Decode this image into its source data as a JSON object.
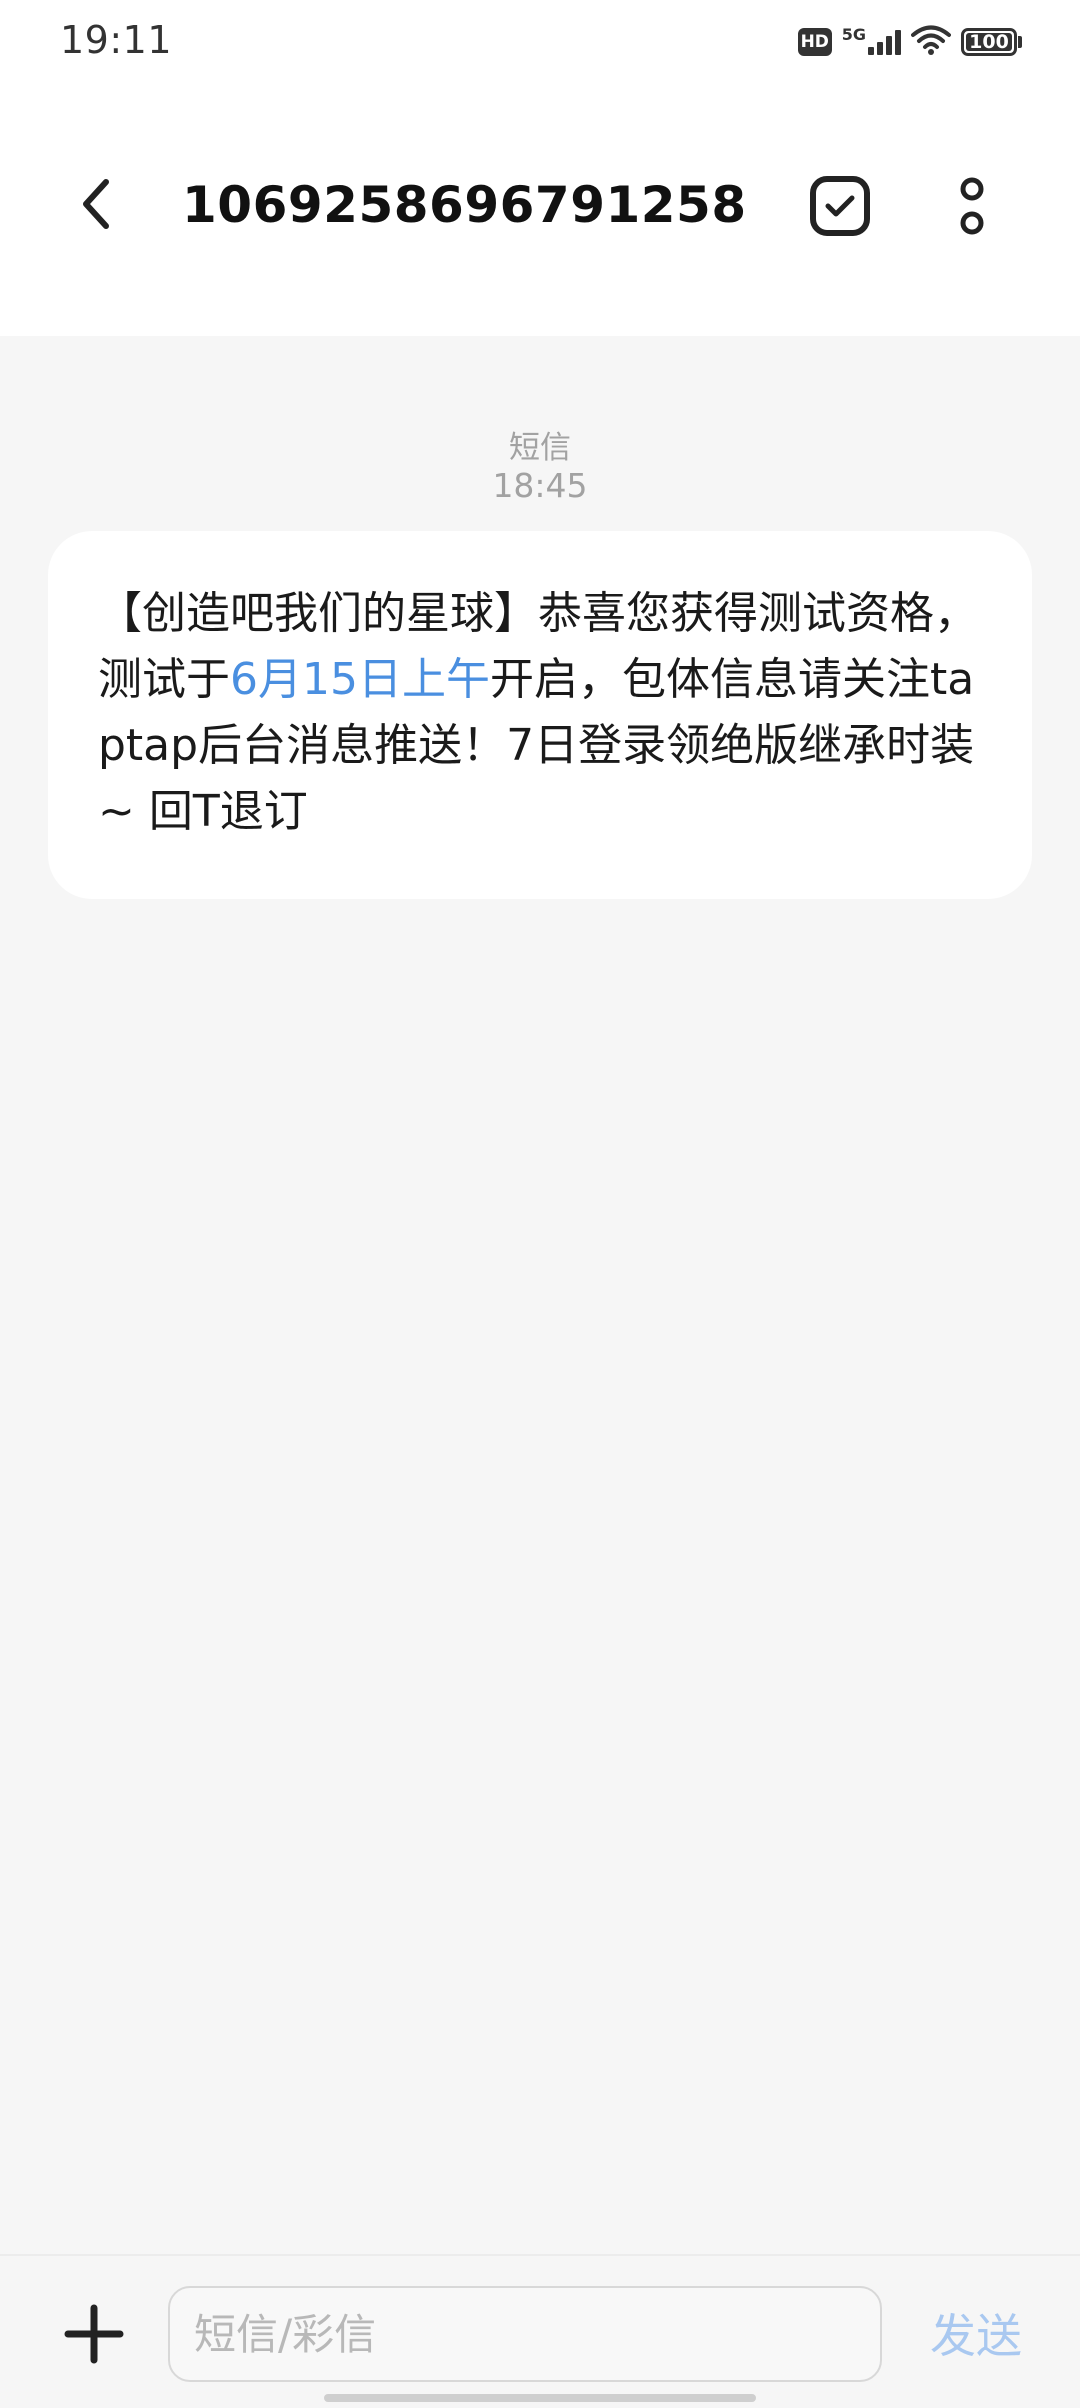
{
  "status_bar": {
    "time": "19:11",
    "hd_label": "HD",
    "network_label": "5G",
    "battery_level": 100,
    "battery_text": "100",
    "icons": [
      "hd-icon",
      "signal-icon",
      "wifi-icon",
      "battery-icon"
    ]
  },
  "header": {
    "title": "1069258696791258",
    "back_icon": "chevron-left-icon",
    "select_icon": "checkbox-icon",
    "more_icon": "more-vertical-icon"
  },
  "conversation": {
    "message_type": "短信",
    "timestamp": "18:45",
    "message": {
      "part_before": "【创造吧我们的星球】恭喜您获得测试资格，测试于",
      "highlight": "6月15日上午",
      "part_after": "开启，包体信息请关注taptap后台消息推送！7日登录领绝版继承时装~ 回T退订"
    }
  },
  "composer": {
    "attach_icon": "plus-icon",
    "input_placeholder": "短信/彩信",
    "input_value": "",
    "send_label": "发送"
  },
  "colors": {
    "accent": "#4a8fe0",
    "send_disabled": "#a9c8f0",
    "background": "#f6f6f6",
    "bubble": "#ffffff"
  }
}
